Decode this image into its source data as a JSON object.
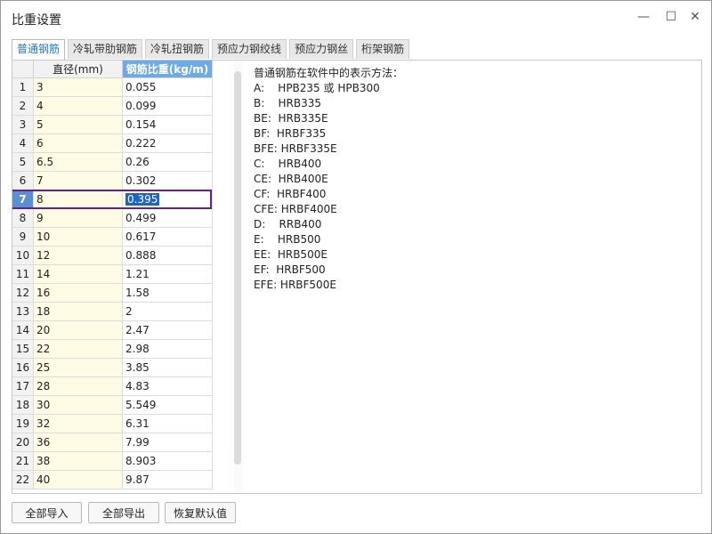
{
  "window": {
    "title": "比重设置",
    "minimize_icon": "minimize-icon",
    "maximize_icon": "maximize-icon",
    "close_icon": "close-icon"
  },
  "tabs": [
    {
      "label": "普通钢筋",
      "active": true
    },
    {
      "label": "冷轧带肋钢筋",
      "active": false
    },
    {
      "label": "冷轧扭钢筋",
      "active": false
    },
    {
      "label": "预应力钢绞线",
      "active": false
    },
    {
      "label": "预应力钢丝",
      "active": false
    },
    {
      "label": "桁架钢筋",
      "active": false
    }
  ],
  "table": {
    "headers": {
      "index": "",
      "diameter": "直径(mm)",
      "weight": "钢筋比重(kg/m)"
    },
    "rows": [
      {
        "no": "1",
        "diameter": "3",
        "weight": "0.055"
      },
      {
        "no": "2",
        "diameter": "4",
        "weight": "0.099"
      },
      {
        "no": "3",
        "diameter": "5",
        "weight": "0.154"
      },
      {
        "no": "4",
        "diameter": "6",
        "weight": "0.222"
      },
      {
        "no": "5",
        "diameter": "6.5",
        "weight": "0.26"
      },
      {
        "no": "6",
        "diameter": "7",
        "weight": "0.302"
      },
      {
        "no": "7",
        "diameter": "8",
        "weight": "0.395"
      },
      {
        "no": "8",
        "diameter": "9",
        "weight": "0.499"
      },
      {
        "no": "9",
        "diameter": "10",
        "weight": "0.617"
      },
      {
        "no": "10",
        "diameter": "12",
        "weight": "0.888"
      },
      {
        "no": "11",
        "diameter": "14",
        "weight": "1.21"
      },
      {
        "no": "12",
        "diameter": "16",
        "weight": "1.58"
      },
      {
        "no": "13",
        "diameter": "18",
        "weight": "2"
      },
      {
        "no": "14",
        "diameter": "20",
        "weight": "2.47"
      },
      {
        "no": "15",
        "diameter": "22",
        "weight": "2.98"
      },
      {
        "no": "16",
        "diameter": "25",
        "weight": "3.85"
      },
      {
        "no": "17",
        "diameter": "28",
        "weight": "4.83"
      },
      {
        "no": "18",
        "diameter": "30",
        "weight": "5.549"
      },
      {
        "no": "19",
        "diameter": "32",
        "weight": "6.31"
      },
      {
        "no": "20",
        "diameter": "36",
        "weight": "7.99"
      },
      {
        "no": "21",
        "diameter": "38",
        "weight": "8.903"
      },
      {
        "no": "22",
        "diameter": "40",
        "weight": "9.87"
      }
    ],
    "selected_row": 7
  },
  "info": {
    "lines": [
      "普通钢筋在软件中的表示方法：",
      "A:    HPB235 或 HPB300",
      "B:    HRB335",
      "BE:  HRB335E",
      "BF:  HRBF335",
      "BFE: HRBF335E",
      "C:    HRB400",
      "CE:  HRB400E",
      "CF:  HRBF400",
      "CFE: HRBF400E",
      "D:    RRB400",
      "E:    HRB500",
      "EE:  HRB500E",
      "EF:  HRBF500",
      "EFE: HRBF500E"
    ]
  },
  "buttons": {
    "import_all": "全部导入",
    "export_all": "全部导出",
    "restore_default": "恢复默认值"
  },
  "colors": {
    "selection_box": "#6d1e86",
    "header_highlight": "#6eaae6",
    "diameter_column_bg": "#fdfbe3",
    "active_tab_text": "#1e78c8"
  }
}
